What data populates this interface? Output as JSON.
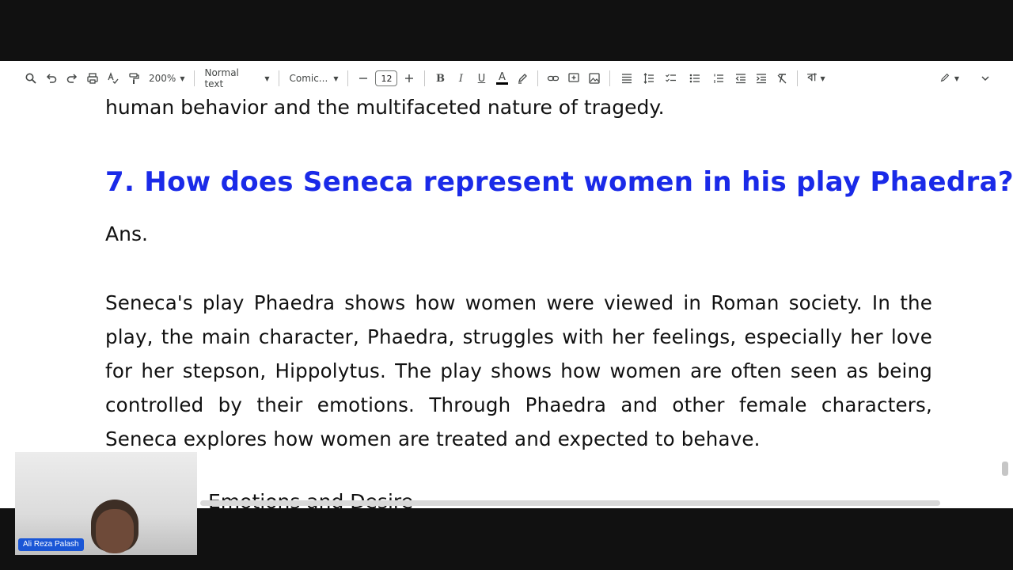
{
  "toolbar": {
    "zoom": "200%",
    "style": "Normal text",
    "font": "Comic...",
    "font_size": "12",
    "bold": "B",
    "italic": "I",
    "underline": "U",
    "text_color": "A",
    "bengali_input": "বা",
    "icons": [
      "search-icon",
      "undo-icon",
      "redo-icon",
      "print-icon",
      "spellcheck-icon",
      "paint-format-icon",
      "link-icon",
      "comment-icon",
      "image-icon",
      "align-icon",
      "line-spacing-icon",
      "checklist-icon",
      "bullet-list-icon",
      "numbered-list-icon",
      "indent-decrease-icon",
      "indent-increase-icon",
      "clear-formatting-icon",
      "edit-mode-icon",
      "collapse-icon"
    ]
  },
  "document": {
    "prev_line": "human behavior and the multifaceted nature of tragedy.",
    "heading": "7. How does Seneca represent women in his play Phaedra?",
    "ans_label": "Ans.",
    "paragraph": "Seneca's play Phaedra shows how women were viewed in Roman society. In the play, the main character, Phaedra, struggles with her feelings, especially her love for her stepson, Hippolytus. The play shows how women are often seen as being controlled by their emotions. Through Phaedra and other female characters, Seneca explores how women are treated and expected to behave.",
    "partial_line": "Emotions and Desire"
  },
  "webcam": {
    "name": "Ali Reza Palash"
  },
  "colors": {
    "heading": "#1a2ae8",
    "toolbar_bg": "#ffffff",
    "frame": "#111111",
    "name_tag": "#1a56d6"
  }
}
